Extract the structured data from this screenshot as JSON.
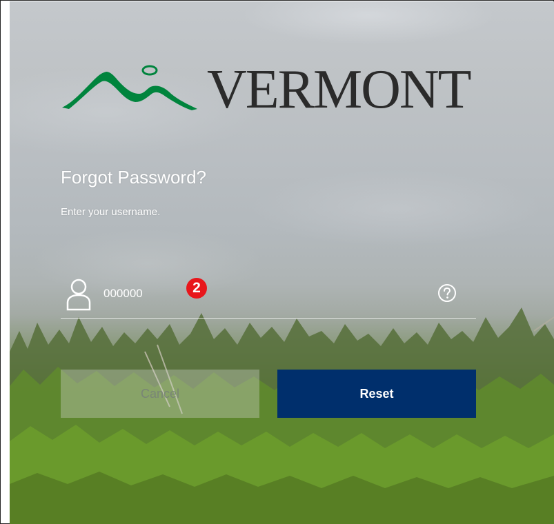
{
  "logo": {
    "text": "VERMONT",
    "color": "#00843d"
  },
  "form": {
    "title": "Forgot Password?",
    "subtitle": "Enter your username.",
    "username_value": "000000",
    "step_badge": "2"
  },
  "buttons": {
    "cancel_label": "Cancel",
    "reset_label": "Reset",
    "reset_color": "#002f6c"
  },
  "icons": {
    "user": "user-icon",
    "help": "question-mark-circle-icon"
  }
}
